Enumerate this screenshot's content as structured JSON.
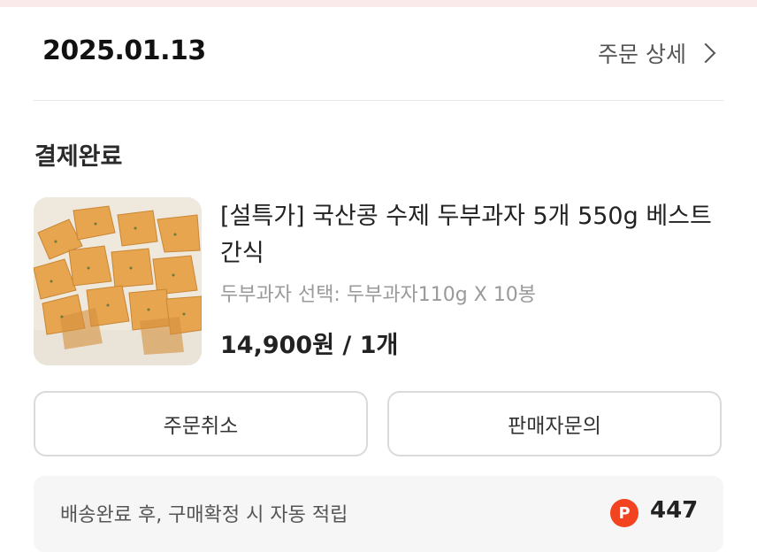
{
  "order": {
    "date": "2025.01.13",
    "detail_label": "주문 상세",
    "status": "결제완료"
  },
  "product": {
    "title": "[설특가] 국산콩 수제 두부과자 5개 550g 베스트 간식",
    "option": "두부과자 선택: 두부과자110g X 10봉",
    "price_qty": "14,900원 / 1개",
    "image_icon": "tofu-snack-photo"
  },
  "actions": {
    "cancel_label": "주문취소",
    "inquiry_label": "판매자문의"
  },
  "points": {
    "note": "배송완료 후, 구매확정 시 자동 적립",
    "icon_letter": "P",
    "value": "447",
    "icon_color": "#f24420"
  }
}
